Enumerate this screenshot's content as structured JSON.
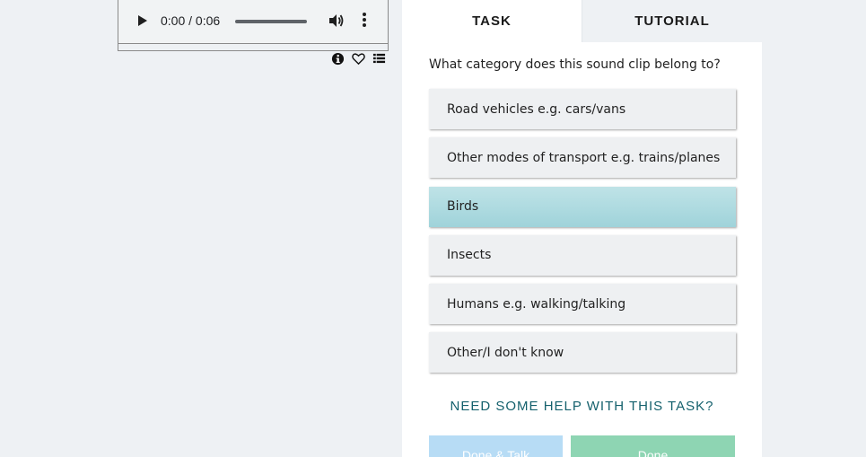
{
  "player": {
    "time_text": "0:00 / 0:06",
    "progress": 0
  },
  "media_icons": [
    "info-icon",
    "heart-icon",
    "list-icon"
  ],
  "tabs": [
    {
      "label": "TASK",
      "active": true
    },
    {
      "label": "TUTORIAL",
      "active": false
    }
  ],
  "task": {
    "question": "What category does this sound clip belong to?",
    "options": [
      {
        "label": "Road vehicles e.g. cars/vans",
        "selected": false
      },
      {
        "label": "Other modes of transport e.g. trains/planes",
        "selected": false
      },
      {
        "label": "Birds",
        "selected": true
      },
      {
        "label": "Insects",
        "selected": false
      },
      {
        "label": "Humans e.g. walking/talking",
        "selected": false
      },
      {
        "label": "Other/I don't know",
        "selected": false
      }
    ],
    "help_link": "NEED SOME HELP WITH THIS TASK?",
    "done_talk_label": "Done & Talk",
    "done_label": "Done"
  },
  "colors": {
    "selected_option": "#a9d8de",
    "help_link": "#15616d",
    "done_talk_button": "#b7dcf5",
    "done_button": "#8ed5b3"
  }
}
